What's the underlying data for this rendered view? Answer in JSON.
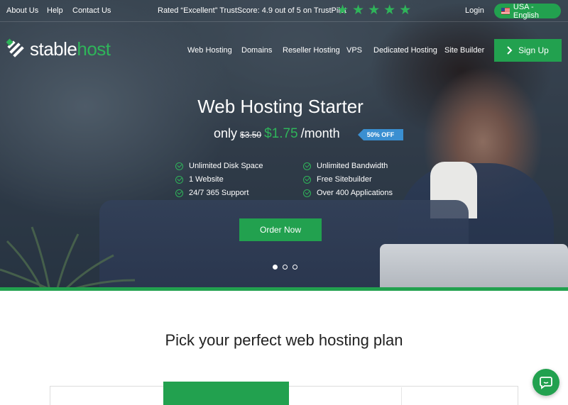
{
  "topbar": {
    "links": [
      "About Us",
      "Help",
      "Contact Us"
    ],
    "trust_text": "Rated “Excellent” TrustScore: 4.9 out of 5 on TrustPilot",
    "stars": 5,
    "login": "Login",
    "language": "USA - English"
  },
  "logo": {
    "part1": "stable",
    "part2": "host"
  },
  "nav": {
    "items": [
      "Web Hosting",
      "Domains",
      "Reseller Hosting",
      "VPS",
      "Dedicated Hosting",
      "Site Builder"
    ],
    "signup": "Sign Up"
  },
  "hero": {
    "title": "Web Hosting Starter",
    "price_prefix": "only",
    "old_price": "$3.50",
    "new_price": "$1.75",
    "price_suffix": "/month",
    "badge": "50% OFF",
    "features": [
      "Unlimited Disk Space",
      "1 Website",
      "24/7 365 Support",
      "Unlimited Bandwidth",
      "Free Sitebuilder",
      "Over 400 Applications"
    ],
    "cta": "Order Now",
    "slides": 3,
    "active_slide": 1
  },
  "plans": {
    "title": "Pick your perfect web hosting plan"
  },
  "colors": {
    "accent": "#22a14f",
    "star": "#2fb45a",
    "badge": "#3a8fd1"
  },
  "icons": [
    "flag-us-icon",
    "logo-mark-icon",
    "chevron-right-icon",
    "check-circle-icon",
    "chat-icon"
  ]
}
